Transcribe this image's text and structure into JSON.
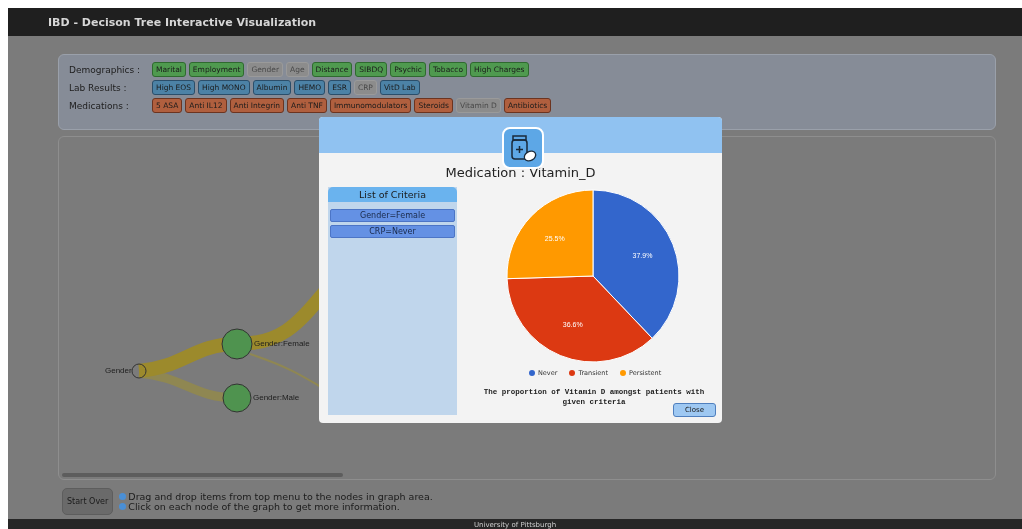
{
  "window": {
    "title": "IBD - Decison Tree Interactive Visualization"
  },
  "menu": [
    {
      "label": "Demographics :",
      "kind": "demo",
      "items": [
        {
          "label": "Marital",
          "disabled": false
        },
        {
          "label": "Employment",
          "disabled": false
        },
        {
          "label": "Gender",
          "disabled": true
        },
        {
          "label": "Age",
          "disabled": true
        },
        {
          "label": "Distance",
          "disabled": false
        },
        {
          "label": "SIBDQ",
          "disabled": false
        },
        {
          "label": "Psychic",
          "disabled": false
        },
        {
          "label": "Tobacco",
          "disabled": false
        },
        {
          "label": "High Charges",
          "disabled": false
        }
      ]
    },
    {
      "label": "Lab Results :",
      "kind": "lab",
      "items": [
        {
          "label": "High EOS",
          "disabled": false
        },
        {
          "label": "High MONO",
          "disabled": false
        },
        {
          "label": "Albumin",
          "disabled": false
        },
        {
          "label": "HEMO",
          "disabled": false
        },
        {
          "label": "ESR",
          "disabled": false
        },
        {
          "label": "CRP",
          "disabled": true
        },
        {
          "label": "VitD Lab",
          "disabled": false
        }
      ]
    },
    {
      "label": "Medications :",
      "kind": "med",
      "items": [
        {
          "label": "5 ASA",
          "disabled": false
        },
        {
          "label": "Anti IL12",
          "disabled": false
        },
        {
          "label": "Anti Integrin",
          "disabled": false
        },
        {
          "label": "Anti TNF",
          "disabled": false
        },
        {
          "label": "Immunomodulators",
          "disabled": false
        },
        {
          "label": "Steroids",
          "disabled": false
        },
        {
          "label": "Vitamin D",
          "disabled": true
        },
        {
          "label": "Antibiotics",
          "disabled": false
        }
      ]
    }
  ],
  "graph": {
    "nodes": [
      {
        "label": "Gender",
        "kind": "root"
      },
      {
        "label": "Gender:Female",
        "kind": "leaf"
      },
      {
        "label": "Gender:Male",
        "kind": "leaf"
      }
    ]
  },
  "bottom": {
    "button": "Start Over",
    "hints": [
      "Drag and drop items from top menu to the nodes in graph area.",
      "Click on each node of the graph to get more information."
    ]
  },
  "footer": "University of Pittsburgh",
  "modal": {
    "title": "Medication : Vitamin_D",
    "criteria_title": "List of Criteria",
    "criteria": [
      "Gender=Female",
      "CRP=Never"
    ],
    "chart_data": {
      "type": "pie",
      "categories": [
        "Never",
        "Transient",
        "Persistent"
      ],
      "colors": [
        "#3366cc",
        "#dc3912",
        "#ff9900"
      ],
      "values": [
        37.9,
        36.6,
        25.5
      ],
      "value_labels": [
        "37.9%",
        "36.6%",
        "25.5%"
      ]
    },
    "caption": "The proportion of Vitamin D amongst patients with given criteria",
    "close": "Close"
  }
}
